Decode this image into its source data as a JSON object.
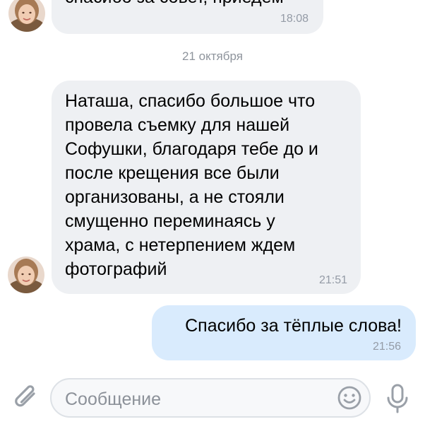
{
  "messages": [
    {
      "direction": "incoming",
      "text": "спасибо за совет, приедем",
      "time": "18:08"
    },
    {
      "direction": "incoming",
      "text": "Наташа, спасибо большое что\nпровела съемку для нашей\nСофушки, благодаря тебе до и\nпосле крещения все были\nорганизованы, а не стояли\nсмущенно переминаясь у\nхрама, с нетерпением ждем\nфотографий",
      "time": "21:51"
    },
    {
      "direction": "outgoing",
      "text": "Спасибо за тёплые слова!",
      "time": "21:56"
    }
  ],
  "date_divider": "21 октября",
  "composer": {
    "placeholder": "Сообщение",
    "icons": {
      "attach": "paperclip-icon",
      "emoji": "smiley-icon",
      "mic": "microphone-icon"
    }
  },
  "colors": {
    "incoming_bubble": "#eef0f3",
    "outgoing_bubble": "#d9ebfd",
    "time_text": "#949ba6",
    "icon_gray": "#9aa0a8"
  }
}
